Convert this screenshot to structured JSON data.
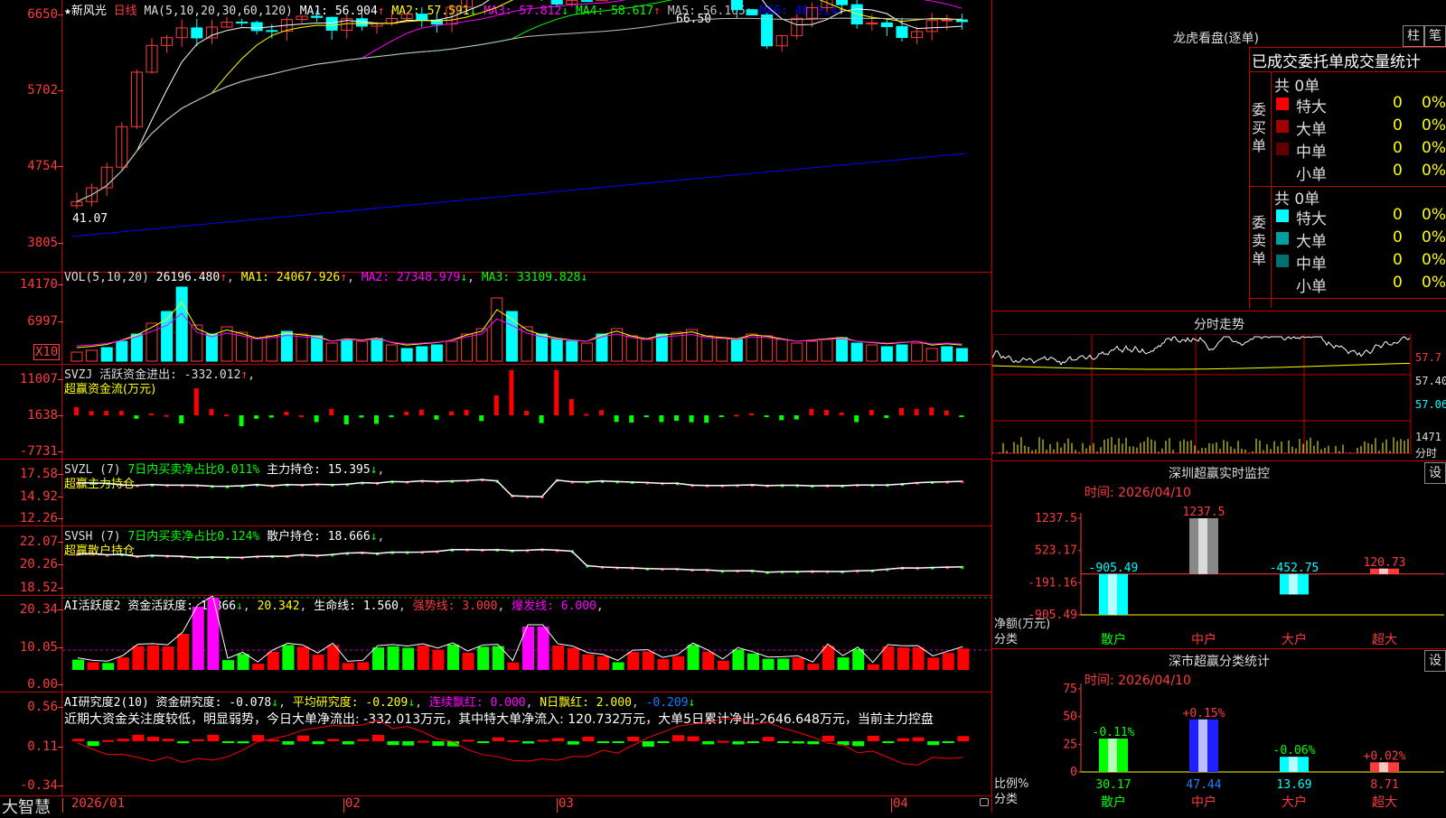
{
  "stock": {
    "title_name": "★新风光",
    "period": "日线"
  },
  "candle_panel": {
    "ma_params": "MA(5,10,20,30,60,120)",
    "ma": [
      {
        "label": "MA1: ",
        "value": "56.904",
        "arrow": "↑",
        "color": "#ffffff"
      },
      {
        "label": "MA2: ",
        "value": "57.591",
        "arrow": "↓",
        "color": "#ffff00"
      },
      {
        "label": "MA3: ",
        "value": "57.812",
        "arrow": "↓",
        "color": "#ff00ff"
      },
      {
        "label": "MA4: ",
        "value": "58.617",
        "arrow": "↑",
        "color": "#00ff00"
      },
      {
        "label": "MA5: ",
        "value": "56.165",
        "arrow": "↑",
        "color": "#c0c0c0"
      },
      {
        "label": "MA6: ",
        "value": "48.914",
        "arrow": "↑",
        "color": "#0000ff"
      }
    ],
    "y_ticks": [
      "6650",
      "5702",
      "4754",
      "3805"
    ],
    "high_label": "66.50",
    "low_label": "41.07"
  },
  "vol_panel": {
    "header": "VOL(5,10,20)",
    "value": "26196.480",
    "ma1": "MA1: 24067.926",
    "ma2": "MA2: 27348.979",
    "ma3": "MA3: 33109.828",
    "y_ticks": [
      "14170",
      "6997"
    ],
    "unit": "X10"
  },
  "svzj": {
    "header": "SVZJ  活跃资金进出: -332.012",
    "sub": "超赢资金流(万元)",
    "y_ticks": [
      "11007",
      "1638",
      "-7731"
    ]
  },
  "svzl": {
    "header_a": "SVZL (7)",
    "header_b": "7日内买卖净占比0.011%",
    "header_c": "主力持仓: 15.395",
    "sub": "超赢主力持仓",
    "y_ticks": [
      "17.58",
      "14.92",
      "12.26"
    ]
  },
  "svsh": {
    "header_a": "SVSH (7)",
    "header_b": "7日内买卖净占比0.124%",
    "header_c": "散户持仓: 18.666",
    "sub": "超赢散户持仓",
    "y_ticks": [
      "22.07",
      "20.26",
      "18.52"
    ]
  },
  "ai_active": {
    "header_a": "AI活跃度2 资金活跃度: 1.866",
    "header_b": "20.342",
    "header_c": "生命线: 1.560",
    "header_d": "强势线: 3.000",
    "header_e": "爆发线: 6.000",
    "y_ticks": [
      "20.34",
      "10.05",
      "0.00"
    ]
  },
  "ai_research": {
    "header_a": "AI研究度2(10) 资金研究度: -0.078",
    "header_b": "平均研究度: -0.209",
    "header_c": "连续飘红: 0.000",
    "header_d": "N日飘红: 2.000",
    "header_e": "-0.209",
    "commentary": "近期大资金关注度较低，明显弱势，今日大单净流出: -332.013万元，其中特大单净流入: 120.732万元，大单5日累计净出-2646.648万元，当前主力控盘",
    "y_ticks": [
      "0.56",
      "0.11",
      "-0.34"
    ]
  },
  "x_axis": {
    "labels": [
      "2026/01",
      "02",
      "03",
      "04"
    ],
    "brand": "大智慧"
  },
  "longhu": {
    "title": "龙虎看盘(逐单)",
    "btn_zhu": "柱",
    "btn_bi": "笔",
    "subtitle": "已成交委托单成交量统计",
    "buy_label": "委买单",
    "sell_label": "委卖单",
    "buy_total": "共 0单",
    "sell_total": "共 0单",
    "buy_rows": [
      {
        "name": "特大",
        "count": "0",
        "pct": "0%",
        "color": "#ff0000"
      },
      {
        "name": "大单",
        "count": "0",
        "pct": "0%",
        "color": "#a00000"
      },
      {
        "name": "中单",
        "count": "0",
        "pct": "0%",
        "color": "#600000"
      },
      {
        "name": "小单",
        "count": "0",
        "pct": "0%",
        "color": ""
      }
    ],
    "sell_rows": [
      {
        "name": "特大",
        "count": "0",
        "pct": "0%",
        "color": "#00ffff"
      },
      {
        "name": "大单",
        "count": "0",
        "pct": "0%",
        "color": "#00a0a0"
      },
      {
        "name": "中单",
        "count": "0",
        "pct": "0%",
        "color": "#007070"
      },
      {
        "name": "小单",
        "count": "0",
        "pct": "0%",
        "color": ""
      }
    ]
  },
  "intraday": {
    "title": "分时走势",
    "right_ticks": [
      "57.7",
      "57.40",
      "57.06"
    ],
    "vol_label": "1471",
    "vol_unit": "分时"
  },
  "sz_realtime": {
    "title": "深圳超赢实时监控",
    "btn": "设",
    "time": "时间: 2026/04/10",
    "y_ticks": [
      "1237.5",
      "523.17",
      "-191.16",
      "-905.49"
    ],
    "axis_label_a": "净额(万元)",
    "axis_label_b": "分类",
    "categories": [
      "散户",
      "中户",
      "大户",
      "超大"
    ],
    "values": [
      -905.49,
      1237.5,
      -452.75,
      120.73
    ],
    "value_labels": [
      "-905.49",
      "1237.5",
      "-452.75",
      "120.73"
    ]
  },
  "sz_category": {
    "title": "深市超赢分类统计",
    "btn": "设",
    "time": "时间: 2026/04/10",
    "y_ticks": [
      "75",
      "50",
      "25",
      "0"
    ],
    "axis_label_a": "比例%",
    "axis_label_b": "分类",
    "categories": [
      "散户",
      "中户",
      "大户",
      "超大"
    ],
    "values": [
      30.17,
      47.44,
      13.69,
      8.71
    ],
    "change_labels": [
      "-0.11%",
      "+0.15%",
      "-0.06%",
      "+0.02%"
    ]
  }
}
